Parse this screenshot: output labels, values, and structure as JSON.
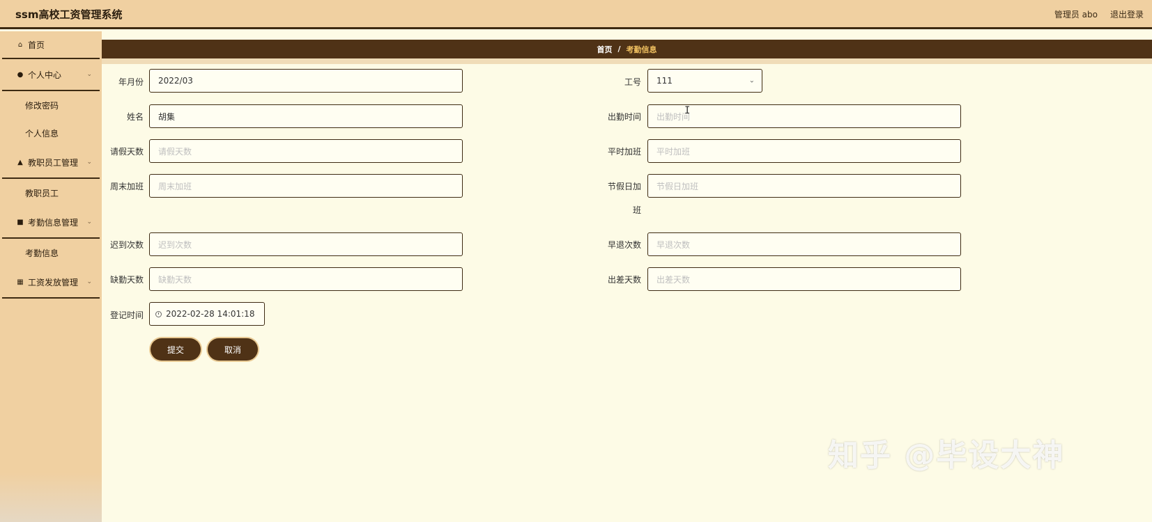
{
  "header": {
    "title": "ssm高校工资管理系统",
    "user": "管理员 abo",
    "logout": "退出登录"
  },
  "sidebar": {
    "home": "首页",
    "personal_center": "个人中心",
    "change_password": "修改密码",
    "personal_info": "个人信息",
    "staff_management": "教职员工管理",
    "staff": "教职员工",
    "attendance_management": "考勤信息管理",
    "attendance_info": "考勤信息",
    "salary_management": "工资发放管理"
  },
  "breadcrumb": {
    "home": "首页",
    "separator": "/",
    "current": "考勤信息"
  },
  "form": {
    "year_month": {
      "label": "年月份",
      "value": "2022/03"
    },
    "employee_id": {
      "label": "工号",
      "value": "111"
    },
    "name": {
      "label": "姓名",
      "value": "胡集"
    },
    "attendance_time": {
      "label": "出勤时间",
      "placeholder": "出勤时间"
    },
    "leave_days": {
      "label": "请假天数",
      "placeholder": "请假天数"
    },
    "weekday_overtime": {
      "label": "平时加班",
      "placeholder": "平时加班"
    },
    "weekend_overtime": {
      "label": "周末加班",
      "placeholder": "周末加班"
    },
    "holiday_overtime": {
      "label_line1": "节假日加",
      "label_line2": "班",
      "placeholder": "节假日加班"
    },
    "late_count": {
      "label": "迟到次数",
      "placeholder": "迟到次数"
    },
    "early_leave_count": {
      "label": "早退次数",
      "placeholder": "早退次数"
    },
    "absence_days": {
      "label": "缺勤天数",
      "placeholder": "缺勤天数"
    },
    "business_trip_days": {
      "label": "出差天数",
      "placeholder": "出差天数"
    },
    "register_time": {
      "label": "登记时间",
      "value": "2022-02-28 14:01:18"
    }
  },
  "buttons": {
    "submit": "提交",
    "cancel": "取消"
  },
  "watermark": "知乎 @毕设大神",
  "colors": {
    "header_bg": "#f0d0a1",
    "dark_brown": "#4f3216",
    "content_bg": "#fdfbe6",
    "breadcrumb_current": "#f0c060"
  }
}
